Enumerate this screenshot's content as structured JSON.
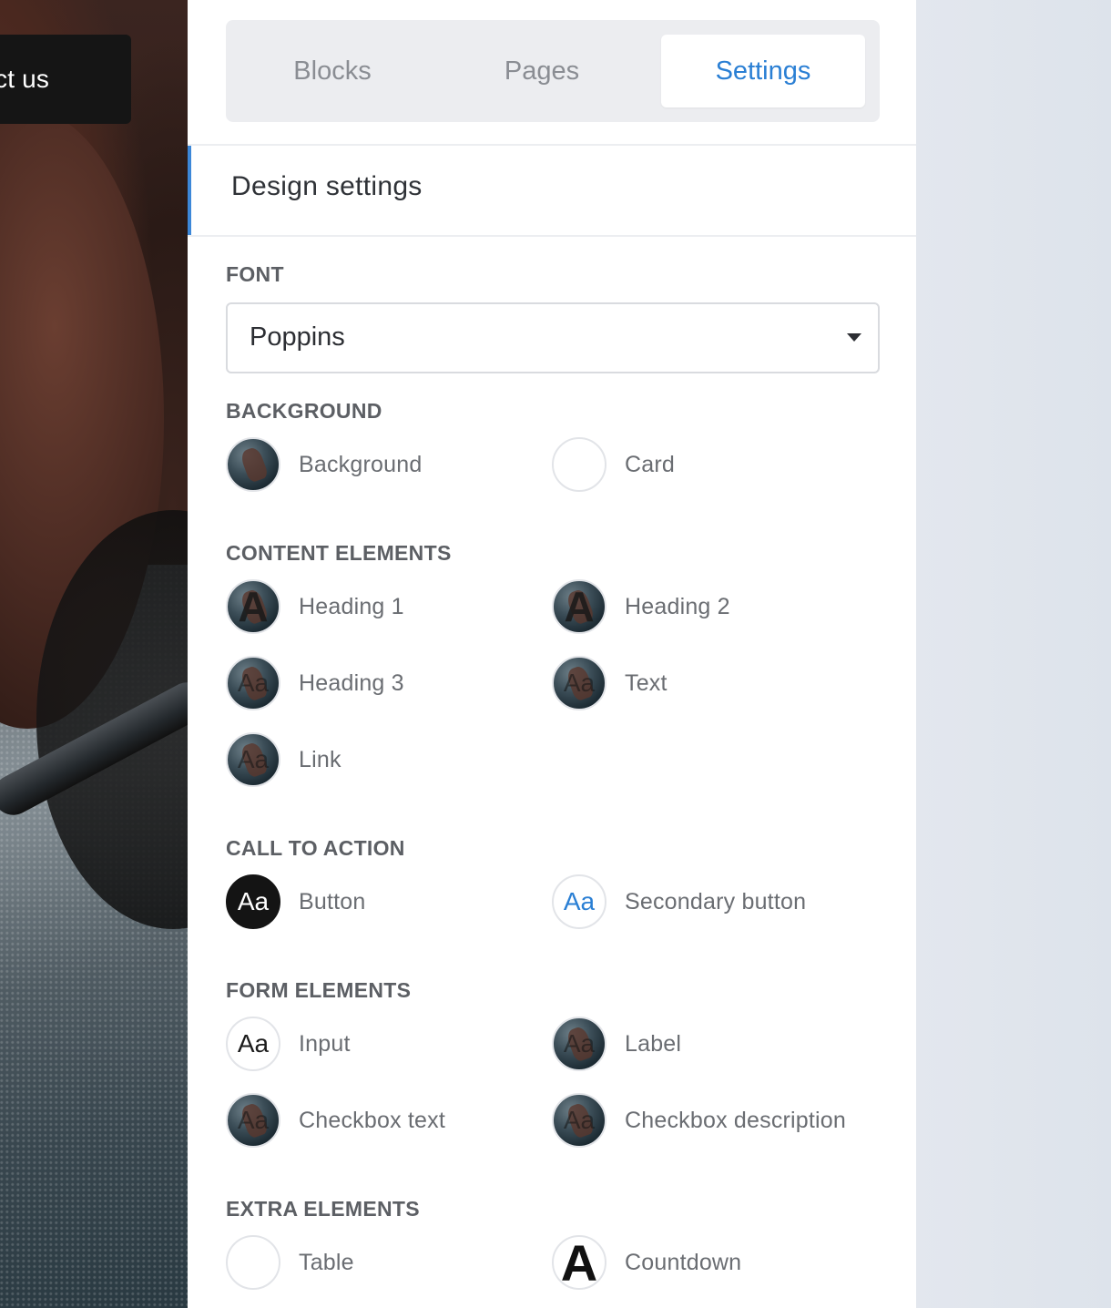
{
  "preview": {
    "contact_button": "ct us"
  },
  "tabs": [
    {
      "label": "Blocks",
      "active": false
    },
    {
      "label": "Pages",
      "active": false
    },
    {
      "label": "Settings",
      "active": true
    }
  ],
  "accent_color": "#2a7fd4",
  "section": {
    "title": "Design settings"
  },
  "font": {
    "label": "FONT",
    "value": "Poppins"
  },
  "background": {
    "label": "BACKGROUND",
    "items": [
      {
        "label": "Background",
        "swatch": "photo"
      },
      {
        "label": "Card",
        "swatch": "white"
      }
    ]
  },
  "content_elements": {
    "label": "CONTENT ELEMENTS",
    "items": [
      {
        "label": "Heading 1",
        "swatch": "photo"
      },
      {
        "label": "Heading 2",
        "swatch": "photo"
      },
      {
        "label": "Heading 3",
        "swatch": "photo",
        "glyph": "Aa"
      },
      {
        "label": "Text",
        "swatch": "photo",
        "glyph": "Aa"
      },
      {
        "label": "Link",
        "swatch": "photo",
        "glyph": "Aa"
      }
    ]
  },
  "call_to_action": {
    "label": "CALL TO ACTION",
    "items": [
      {
        "label": "Button",
        "swatch": "black",
        "glyph": "Aa"
      },
      {
        "label": "Secondary button",
        "swatch": "white",
        "glyph": "Aa"
      }
    ]
  },
  "form_elements": {
    "label": "FORM ELEMENTS",
    "items": [
      {
        "label": "Input",
        "swatch": "white",
        "glyph": "Aa"
      },
      {
        "label": "Label",
        "swatch": "photo",
        "glyph": "Aa"
      },
      {
        "label": "Checkbox text",
        "swatch": "photo",
        "glyph": "Aa"
      },
      {
        "label": "Checkbox description",
        "swatch": "photo",
        "glyph": "Aa"
      }
    ]
  },
  "extra_elements": {
    "label": "EXTRA ELEMENTS",
    "items": [
      {
        "label": "Table",
        "swatch": "white"
      },
      {
        "label": "Countdown",
        "swatch": "white",
        "glyph": "A"
      }
    ]
  }
}
